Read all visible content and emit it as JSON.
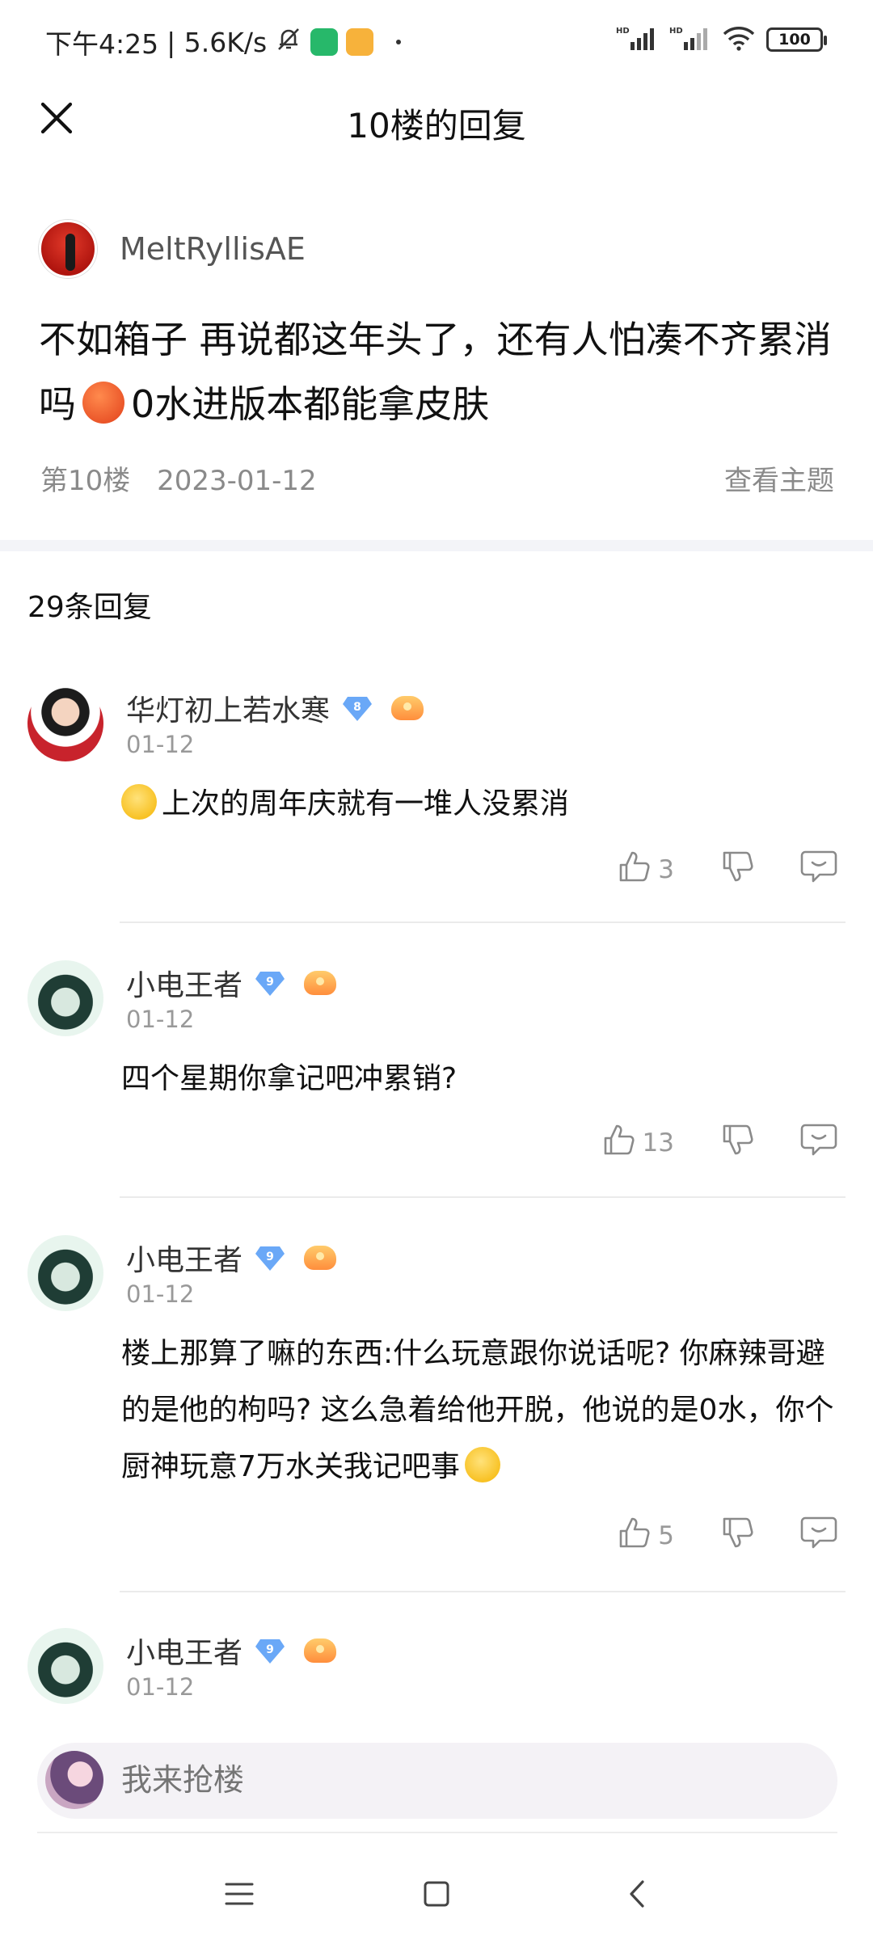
{
  "status_bar": {
    "time": "下午4:25",
    "net_speed": "| 5.6K/s",
    "battery": "100"
  },
  "header": {
    "title": "10楼的回复"
  },
  "post": {
    "author": "MeltRyllisAE",
    "text_part1": "不如箱子 再说都这年头了，还有人怕凑不齐累消吗",
    "text_part2": "0水进版本都能拿皮肤",
    "floor": "第10楼",
    "date": "2023-01-12",
    "view_topic": "查看主题"
  },
  "reply_count": "29条回复",
  "replies": [
    {
      "name": "华灯初上若水寒",
      "level": "8",
      "date": "01-12",
      "text": "上次的周年庆就有一堆人没累消",
      "likes": "3"
    },
    {
      "name": "小电王者",
      "level": "9",
      "date": "01-12",
      "text": "四个星期你拿记吧冲累销?",
      "likes": "13"
    },
    {
      "name": "小电王者",
      "level": "9",
      "date": "01-12",
      "text": "楼上那算了嘛的东西:什么玩意跟你说话呢? 你麻辣哥避的是他的枸吗? 这么急着给他开脱，他说的是0水，你个厨神玩意7万水关我记吧事",
      "likes": "5"
    },
    {
      "name": "小电王者",
      "level": "9",
      "date": "01-12"
    }
  ],
  "input": {
    "placeholder": "我来抢楼"
  },
  "icons": {
    "close": "close-icon",
    "like": "thumbs-up-icon",
    "dislike": "thumbs-down-icon",
    "comment": "comment-icon",
    "nav_menu": "menu-icon",
    "nav_home": "home-icon",
    "nav_back": "back-icon"
  },
  "colors": {
    "level_badge": "#6aa8f7",
    "muted_text": "#999999",
    "divider_band": "#f3f4f8"
  }
}
